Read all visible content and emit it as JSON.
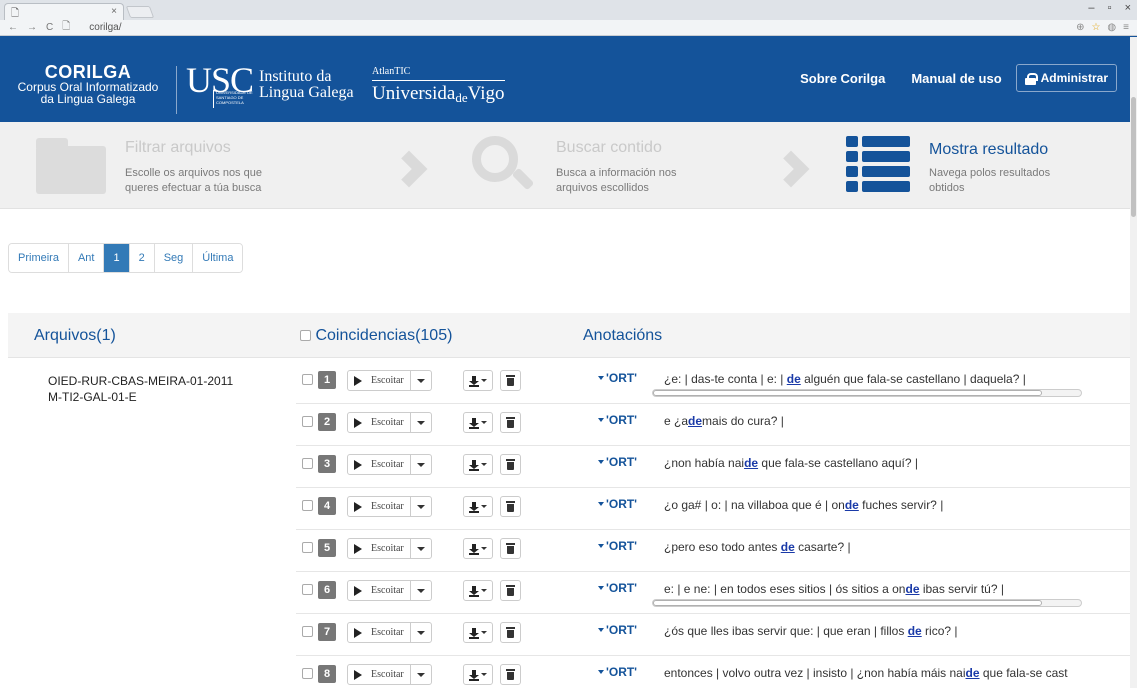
{
  "browser": {
    "tab_title": "",
    "url": "corilga/"
  },
  "header": {
    "brand_title": "CORILGA",
    "brand_sub1": "Corpus Oral Informatizado",
    "brand_sub2": "da Lingua Galega",
    "usc": "USC",
    "usc_caption": "UNIVERSIDADE DE SANTIAGO DE COMPOSTELA",
    "instituto1": "Instituto da",
    "instituto2": "Lingua Galega",
    "atlantic": "AtlanTIC",
    "uvigo_a": "Universida",
    "uvigo_b": "de",
    "uvigo_c": "Vigo",
    "nav_about": "Sobre Corilga",
    "nav_manual": "Manual de uso",
    "nav_admin": "Administrar",
    "color": "#14539a"
  },
  "steps": {
    "filter_title": "Filtrar arquivos",
    "filter_sub1": "Escolle os arquivos nos que",
    "filter_sub2": "queres efectuar a túa busca",
    "search_title": "Buscar contido",
    "search_sub1": "Busca a información nos",
    "search_sub2": "arquivos escollidos",
    "show_title": "Mostra resultado",
    "show_sub1": "Navega polos resultados",
    "show_sub2": "obtidos"
  },
  "pagination": {
    "first": "Primeira",
    "prev": "Ant",
    "p1": "1",
    "p2": "2",
    "next": "Seg",
    "last": "Última",
    "current": 1
  },
  "results": {
    "files_title": "Arquivos(1)",
    "matches_title": "Coincidencias(105)",
    "annotations_title": "Anotacións",
    "file_line1": "OIED-RUR-CBAS-MEIRA-01-2011",
    "file_line2": "M-TI2-GAL-01-E",
    "play_label": "Escoitar",
    "ort_label": "'ORT'",
    "rows": [
      {
        "n": "1",
        "pre": "¿e: | das-te conta | e: | ",
        "hit": "de",
        "post": " alguén que fala-se castellano | daquela? |"
      },
      {
        "n": "2",
        "pre": "e ¿a",
        "hit": "de",
        "post": "mais do cura? |"
      },
      {
        "n": "3",
        "pre": "¿non había nai",
        "hit": "de",
        "post": " que fala-se castellano aquí? |"
      },
      {
        "n": "4",
        "pre": "¿o ga# | o: | na villaboa que é | on",
        "hit": "de",
        "post": " fuches servir? |"
      },
      {
        "n": "5",
        "pre": "¿pero eso todo antes ",
        "hit": "de",
        "post": " casarte? |"
      },
      {
        "n": "6",
        "pre": "e: | e ne: | en todos eses sitios | ós sitios a on",
        "hit": "de",
        "post": " ibas servir tú? |"
      },
      {
        "n": "7",
        "pre": "¿ós que lles ibas servir que: | que eran | fillos ",
        "hit": "de",
        "post": " rico? |"
      },
      {
        "n": "8",
        "pre": "entonces | volvo outra vez | insisto | ¿non había máis nai",
        "hit": "de",
        "post": " que fala-se cast"
      }
    ]
  }
}
